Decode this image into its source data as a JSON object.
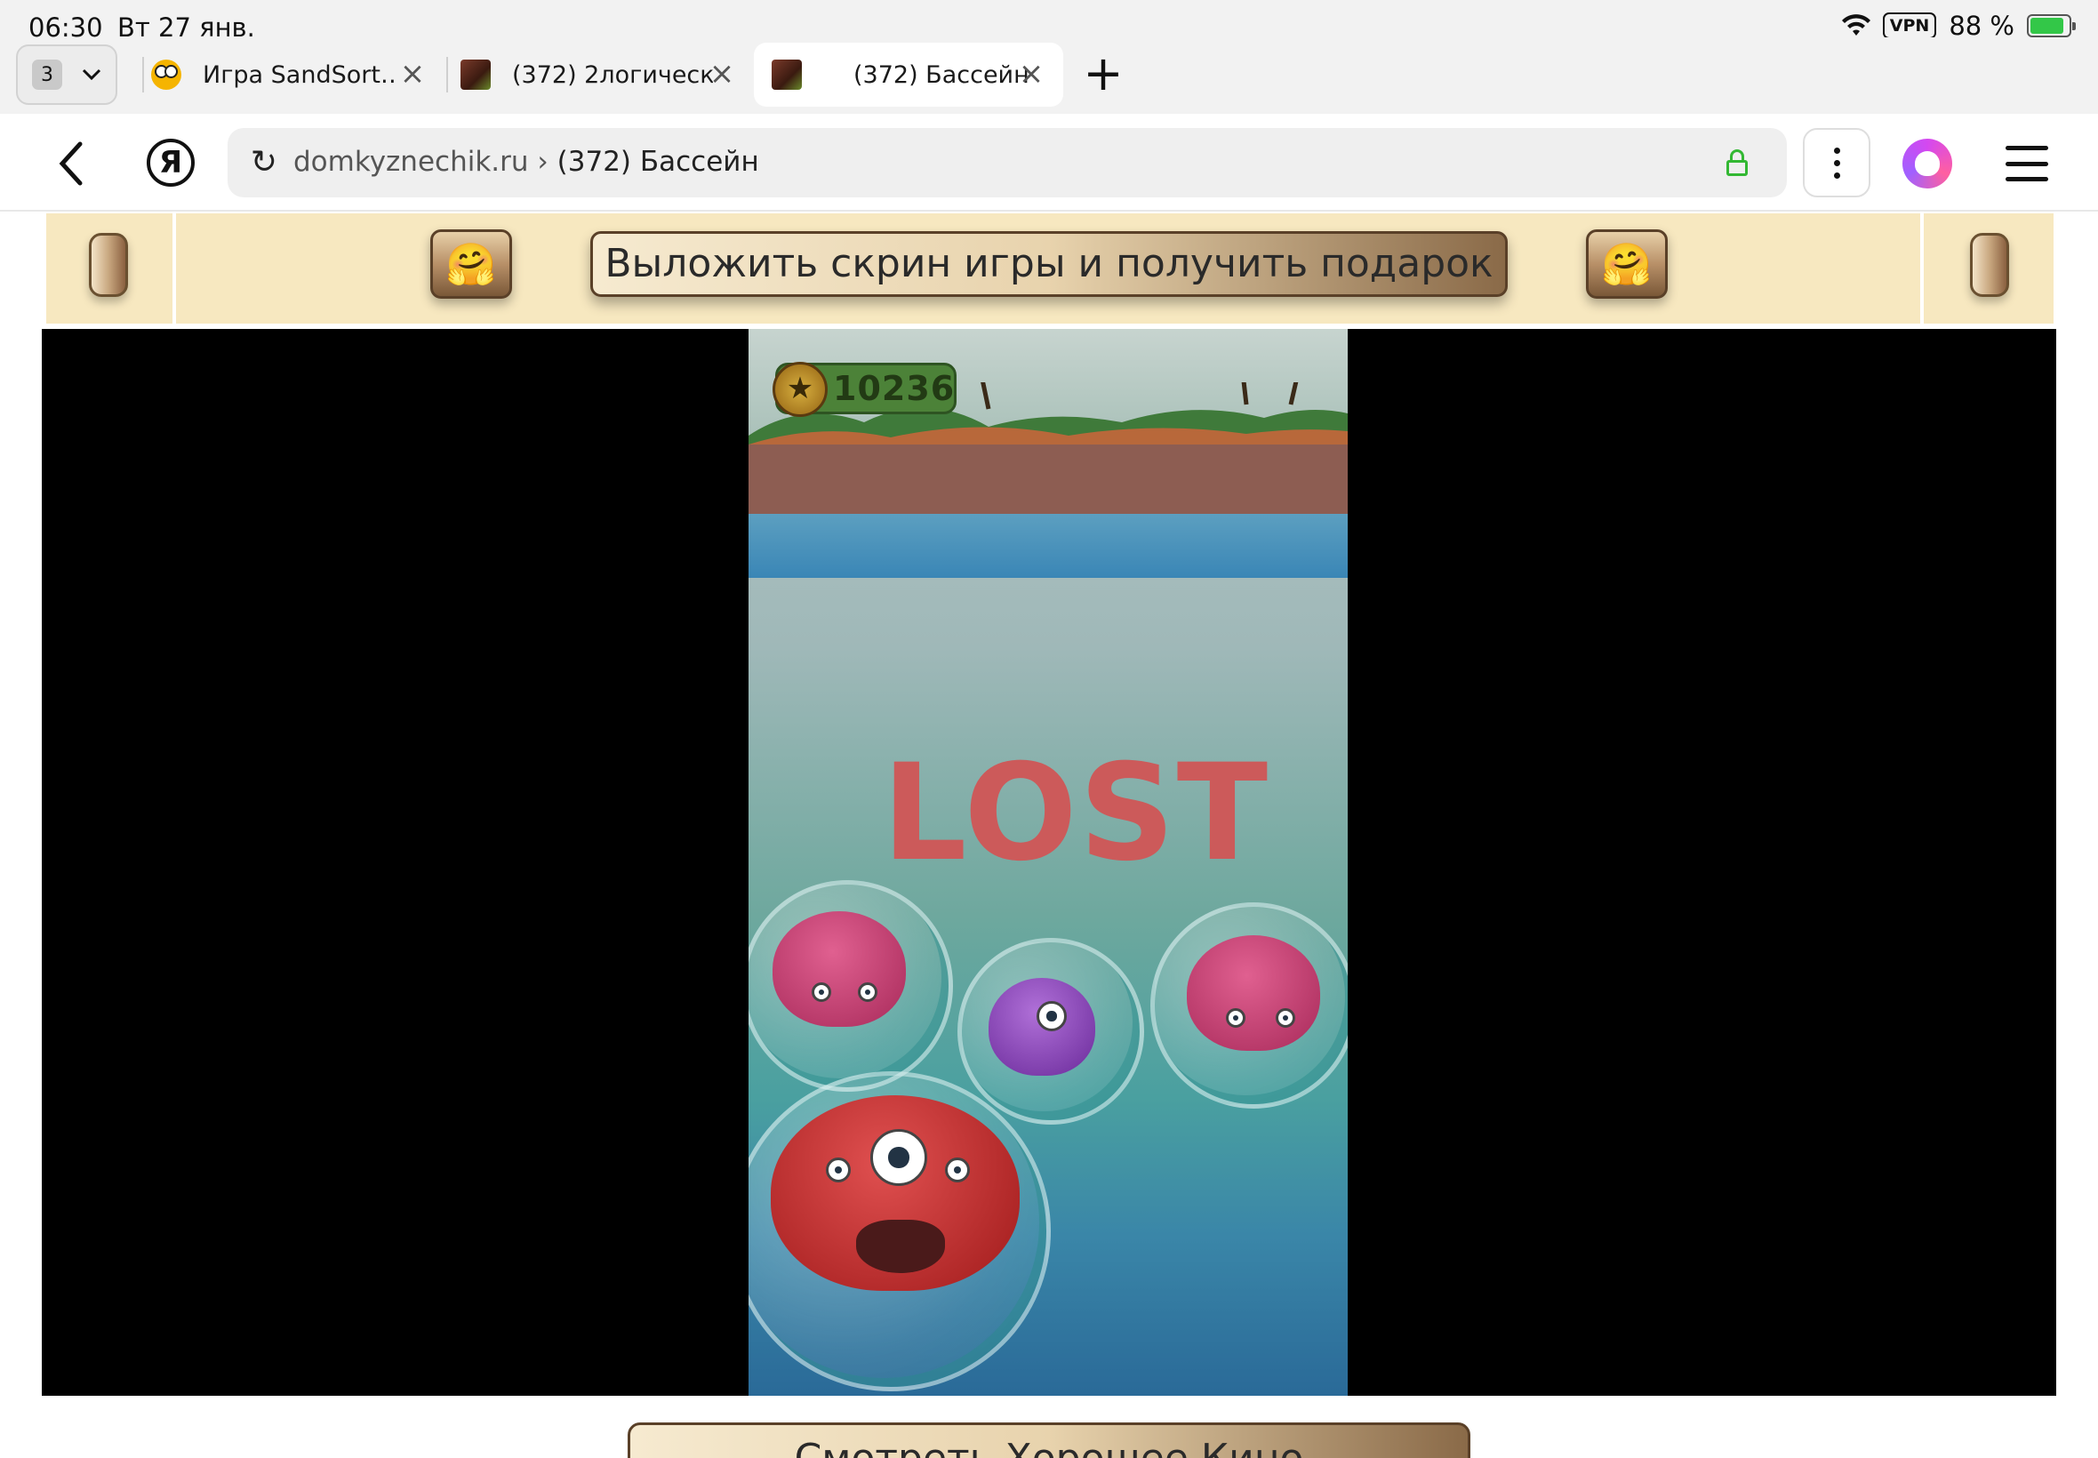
{
  "status_bar": {
    "time": "06:30",
    "date": "Вт 27 янв.",
    "vpn": "VPN",
    "battery": "88 %",
    "battery_level": 0.88
  },
  "tabs": {
    "count": "3",
    "items": [
      {
        "title": "Игра SandSort…",
        "favicon": "game-face-icon",
        "active": false
      },
      {
        "title": "(372) 2логическ…",
        "favicon": "site-icon",
        "active": false
      },
      {
        "title": "(372) Бассейн",
        "favicon": "site-icon",
        "active": true
      }
    ]
  },
  "address": {
    "domain": "domkyznechik.ru",
    "separator": "›",
    "page_title": "(372) Бассейн"
  },
  "banner": {
    "cta_label": "Выложить скрин игры и получить подарок",
    "emoji": "🤗"
  },
  "game": {
    "coins": "10236",
    "status_text": "LOST"
  },
  "bottom_button": {
    "label": "Смотреть Хорошее Кино"
  },
  "colors": {
    "banner_bg": "#f7e8c0",
    "lost_text": "#cc5a5a",
    "lock_green": "#33b833"
  }
}
